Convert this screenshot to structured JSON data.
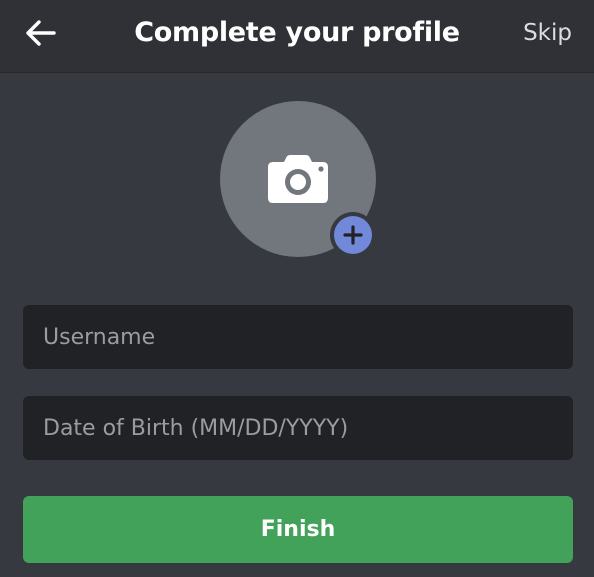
{
  "header": {
    "title": "Complete your profile",
    "skip_label": "Skip",
    "back_icon": "arrow-left-icon"
  },
  "avatar": {
    "icon": "camera-icon",
    "badge_icon": "plus-icon",
    "badge_color": "#7289da"
  },
  "form": {
    "username": {
      "placeholder": "Username",
      "value": ""
    },
    "dob": {
      "placeholder": "Date of Birth (MM/DD/YYYY)",
      "value": ""
    },
    "finish_label": "Finish",
    "finish_color": "#43a25a"
  },
  "theme": {
    "background": "#36393f",
    "header_background": "#2f3136",
    "field_background": "#202225"
  }
}
